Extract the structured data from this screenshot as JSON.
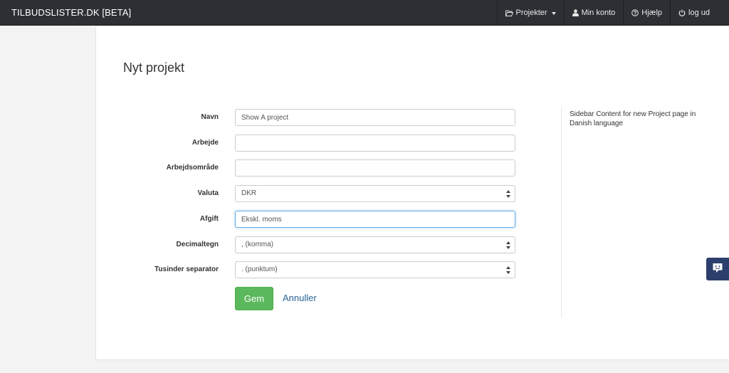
{
  "navbar": {
    "brand": "TILBUDSLISTER.DK [BETA]",
    "items": [
      {
        "label": "Projekter",
        "icon": "folder-open-icon",
        "dropdown": true
      },
      {
        "label": "Min konto",
        "icon": "user-icon"
      },
      {
        "label": "Hjælp",
        "icon": "question-circle-icon"
      },
      {
        "label": "log ud",
        "icon": "power-icon"
      }
    ]
  },
  "page": {
    "title": "Nyt projekt"
  },
  "form": {
    "fields": [
      {
        "label": "Navn",
        "type": "text",
        "value": "Show A project"
      },
      {
        "label": "Arbejde",
        "type": "text",
        "value": ""
      },
      {
        "label": "Arbejdsområde",
        "type": "text",
        "value": ""
      },
      {
        "label": "Valuta",
        "type": "select",
        "value": "DKR"
      },
      {
        "label": "Afgift",
        "type": "text",
        "value": "Ekskl. moms"
      },
      {
        "label": "Decimaltegn",
        "type": "select",
        "value": ", (komma)"
      },
      {
        "label": "Tusinder separator",
        "type": "select",
        "value": ". (punktum)"
      }
    ],
    "save_label": "Gem",
    "cancel_label": "Annuller"
  },
  "sidebar": {
    "content": "Sidebar Content for new Project page in Danish language"
  },
  "colors": {
    "navbar_bg": "#2c3034",
    "save_button": "#5cb85c",
    "link": "#2a6496",
    "chat_widget": "#2c3e6b"
  }
}
